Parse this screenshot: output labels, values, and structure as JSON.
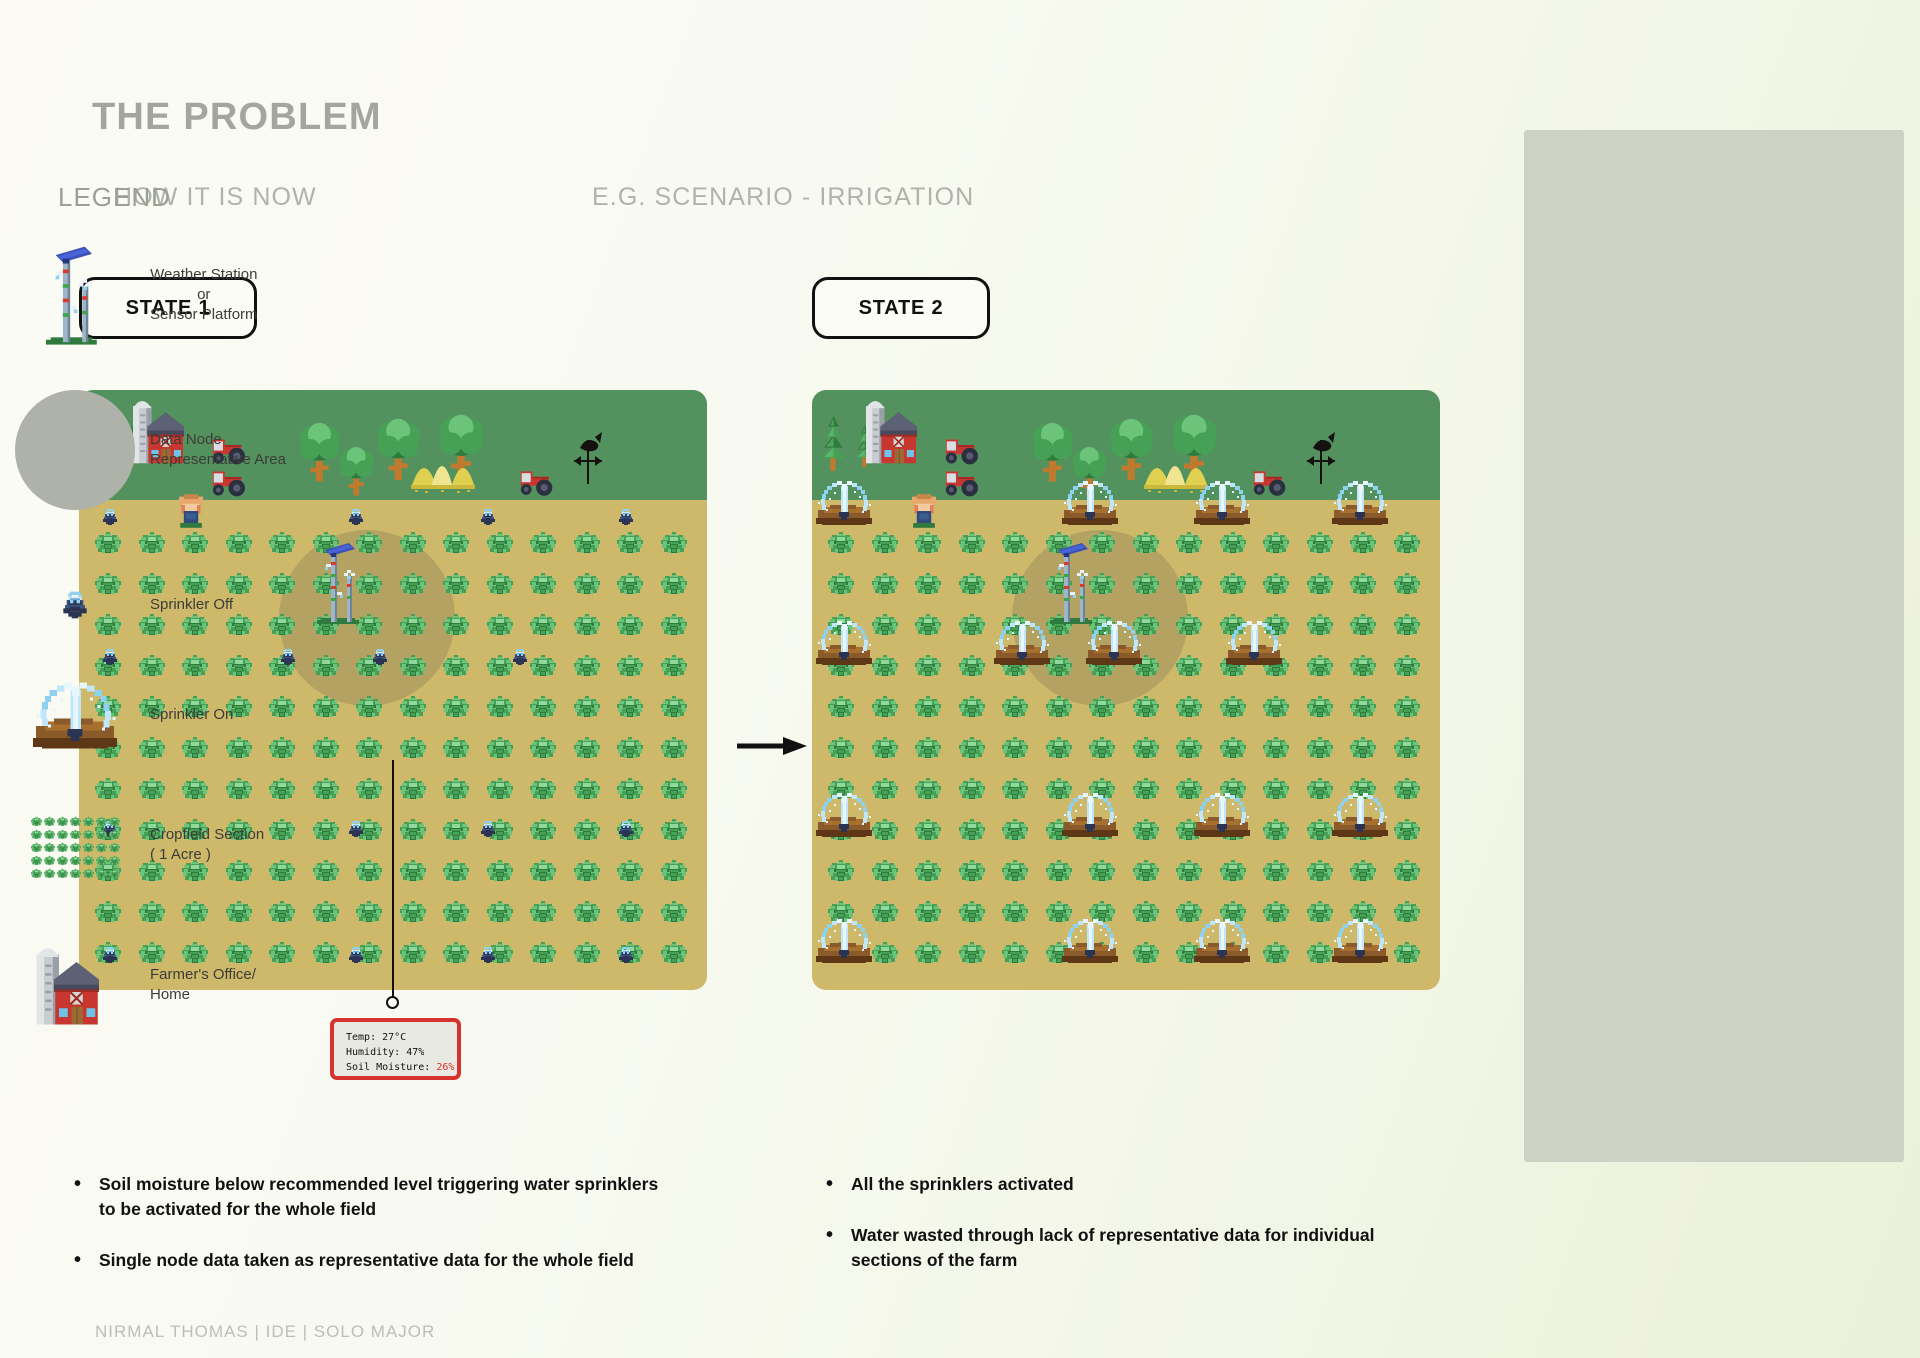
{
  "header": {
    "title": "THE PROBLEM",
    "subtitle_left": "HOW IT IS NOW",
    "subtitle_center": "E.G. SCENARIO - IRRIGATION"
  },
  "states": {
    "state1_label": "STATE 1",
    "state2_label": "STATE 2"
  },
  "sensor_readout": {
    "temp_line": "Temp: 27°C",
    "humidity_line": "Humidity: 47%",
    "soil_label": "Soil Moisture: ",
    "soil_value": "26%",
    "alert_color": "#e02b22"
  },
  "bullets_state1": [
    "Soil moisture below recommended level triggering water sprinklers to be activated  for the whole field",
    "Single node data taken as representative data for the whole field"
  ],
  "bullets_state2": [
    "All the sprinklers activated",
    "Water wasted through lack of representative data for individual sections of the farm"
  ],
  "legend": {
    "title": "LEGEND",
    "items": [
      {
        "icon": "weather-station-icon",
        "label_line1": "Weather  Station",
        "label_line2": "or",
        "label_line3": "Sensor Platform"
      },
      {
        "icon": "data-node-area-icon",
        "label_line1": "Data Node",
        "label_line2": "Representative Area"
      },
      {
        "icon": "sprinkler-off-icon",
        "label_line1": "Sprinkler Off"
      },
      {
        "icon": "sprinkler-on-icon",
        "label_line1": "Sprinkler On"
      },
      {
        "icon": "cropfield-section-icon",
        "label_line1": "Cropfield Section",
        "label_line2": "( 1 Acre )"
      },
      {
        "icon": "farm-house-icon",
        "label_line1": "Farmer's Office/",
        "label_line2": "Home"
      }
    ]
  },
  "footer": {
    "credit": "NIRMAL THOMAS | IDE | SOLO MAJOR"
  },
  "colors": {
    "grass": "#53925e",
    "soil": "#ceb86a",
    "legend_panel": "#ccd2c4",
    "title_grey": "#a3a5a0",
    "alert_red": "#d6332f",
    "wet_soil": "#8a5a2b",
    "water": "#a8dcf5"
  }
}
